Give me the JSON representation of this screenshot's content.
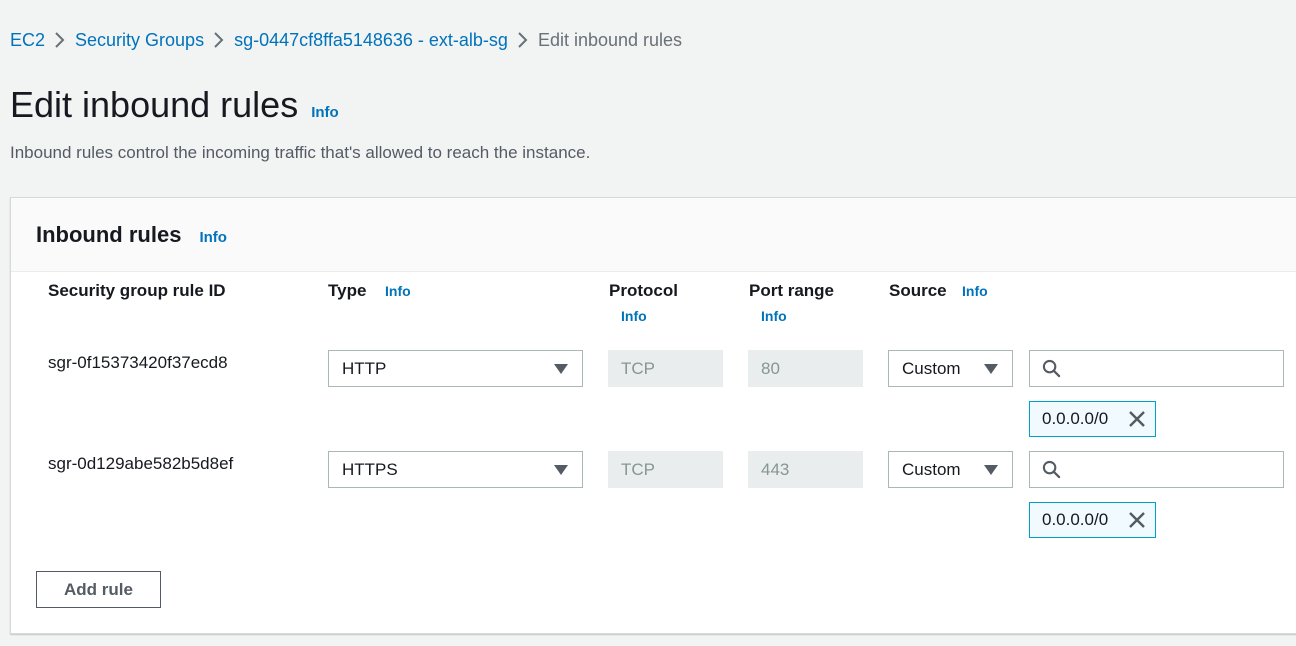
{
  "breadcrumb": {
    "items": [
      {
        "label": "EC2"
      },
      {
        "label": "Security Groups"
      },
      {
        "label": "sg-0447cf8ffa5148636 - ext-alb-sg"
      },
      {
        "label": "Edit inbound rules"
      }
    ]
  },
  "page": {
    "title": "Edit inbound rules",
    "info": "Info",
    "description": "Inbound rules control the incoming traffic that's allowed to reach the instance."
  },
  "panel": {
    "title": "Inbound rules",
    "info": "Info",
    "columns": {
      "rule_id": "Security group rule ID",
      "type": "Type",
      "type_info": "Info",
      "protocol": "Protocol",
      "protocol_info": "Info",
      "port_range": "Port range",
      "port_range_info": "Info",
      "source": "Source",
      "source_info": "Info"
    },
    "rules": [
      {
        "id": "sgr-0f15373420f37ecd8",
        "type": "HTTP",
        "protocol": "TCP",
        "port": "80",
        "source": "Custom",
        "search_value": "",
        "cidr": "0.0.0.0/0"
      },
      {
        "id": "sgr-0d129abe582b5d8ef",
        "type": "HTTPS",
        "protocol": "TCP",
        "port": "443",
        "source": "Custom",
        "search_value": "",
        "cidr": "0.0.0.0/0"
      }
    ],
    "add_rule_label": "Add rule"
  },
  "icons": {
    "separator": "chevron-right-icon",
    "dropdown": "caret-down-icon",
    "search": "search-icon",
    "remove": "close-icon"
  },
  "colors": {
    "link": "#0073bb",
    "background": "#f2f3f3",
    "token_border": "#00a1c9"
  }
}
